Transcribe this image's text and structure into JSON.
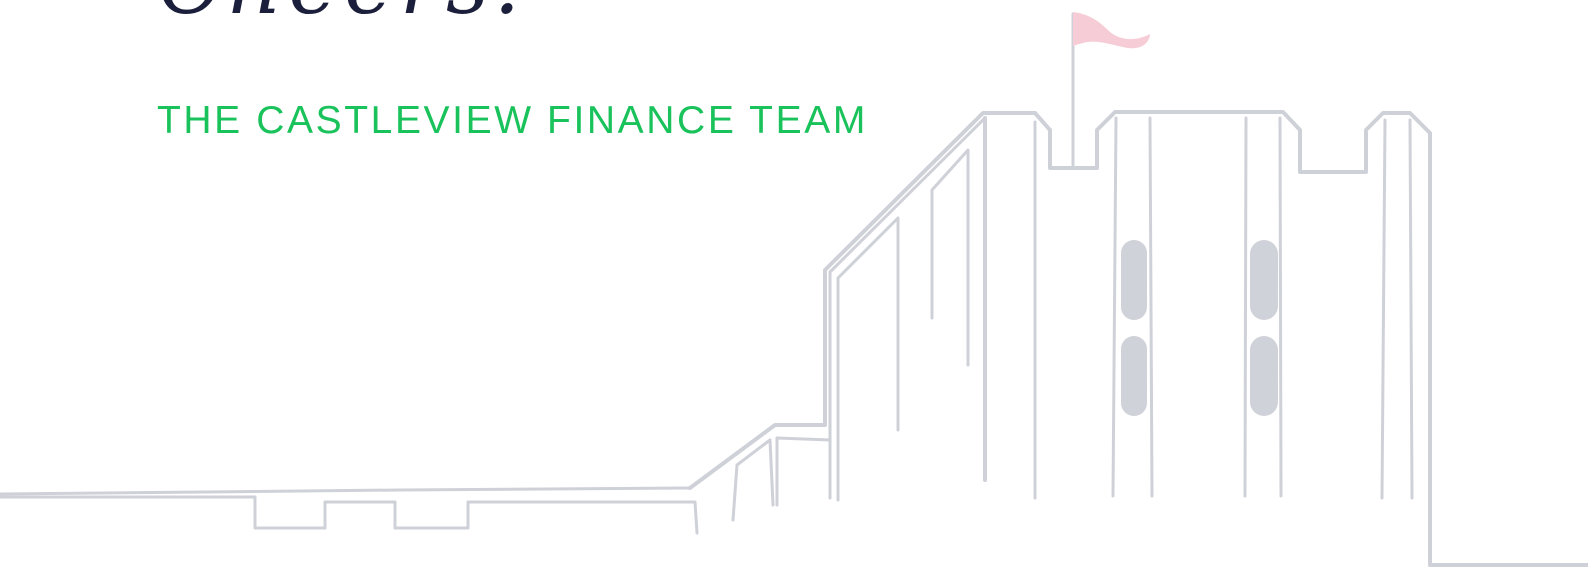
{
  "signoff": "Cheers!",
  "team_name": "THE CASTLEVIEW FINANCE TEAM",
  "colors": {
    "team_text": "#19c25a",
    "signoff_text": "#1b1f3b",
    "castle_line": "#cfd1d8",
    "flag": "#f6cdd6"
  }
}
